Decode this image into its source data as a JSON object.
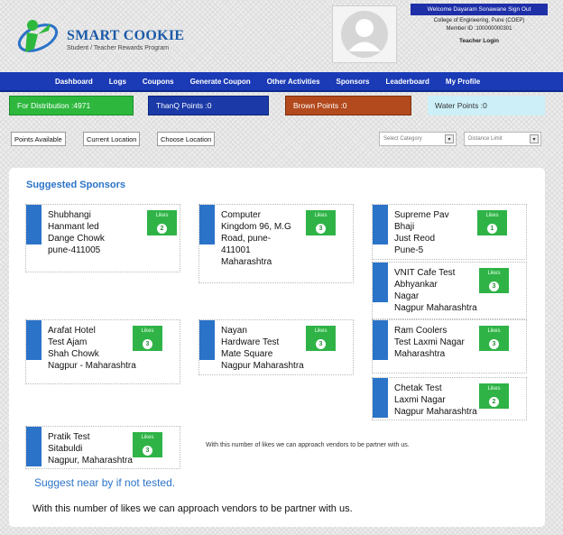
{
  "brand": {
    "name": "SMART COOKIE",
    "tagline": "Student / Teacher Rewards Program",
    "colors": {
      "primary": "#1a5aa8",
      "accent_green": "#2db83d"
    }
  },
  "user": {
    "welcome": "Welcome Dayaram Sonawane Sign Out",
    "college": "College of Engineering, Pune (COEP)",
    "member_id": "Member ID :100000000301",
    "role": "Teacher Login"
  },
  "nav": {
    "items": [
      {
        "label": "Dashboard"
      },
      {
        "label": "Logs"
      },
      {
        "label": "Coupons"
      },
      {
        "label": "Generate Coupon"
      },
      {
        "label": "Other Activities"
      },
      {
        "label": "Sponsors"
      },
      {
        "label": "Leaderboard"
      },
      {
        "label": "My Profile"
      }
    ]
  },
  "points": {
    "distribution": "For Distribution :4971",
    "thanq": "ThanQ Points :0",
    "brown": "Brown Points :0",
    "water": "Water Points :0"
  },
  "filters": {
    "points_available": "Points Available",
    "current_location": "Current Location",
    "choose_location": "Choose Location",
    "category_placeholder": "Select Category",
    "distance_placeholder": "Distance Limit"
  },
  "main": {
    "title": "Suggested Sponsors",
    "likes_label": "Likes",
    "sponsors": [
      {
        "name": "Shubhangi\nHanmant led\nDange Chowk\npune-411005",
        "likes": "2"
      },
      {
        "name": "Computer\nKingdom 96, M.G\nRoad, pune-\n411001\nMaharashtra",
        "likes": "3"
      },
      {
        "name": "Supreme Pav\nBhaji\nJust Reod\nPune-5",
        "likes": "1"
      },
      {
        "name": "VNIT Cafe Test\nAbhyankar\nNagar\nNagpur Maharashtra",
        "likes": "3"
      },
      {
        "name": "Arafat Hotel\nTest Ajam\nShah Chowk\nNagpur - Maharashtra",
        "likes": "3"
      },
      {
        "name": "Nayan\nHardware Test\nMate Square\nNagpur Maharashtra",
        "likes": "3"
      },
      {
        "name": "Ram Coolers\nTest Laxmi Nagar\nMaharashtra",
        "likes": "3"
      },
      {
        "name": "Chetak Test\nLaxmi Nagar\nNagpur Maharashtra",
        "likes": "2"
      },
      {
        "name": "Pratik Test\nSitabuldi\nNagpur, Maharashtra",
        "likes": "3"
      }
    ],
    "small_note": "With this number of likes we can approach vendors to be partner with us.",
    "suggest_text": "Suggest near by if not tested.",
    "footer_note": "With this number of likes we can approach vendors to be partner with us."
  }
}
